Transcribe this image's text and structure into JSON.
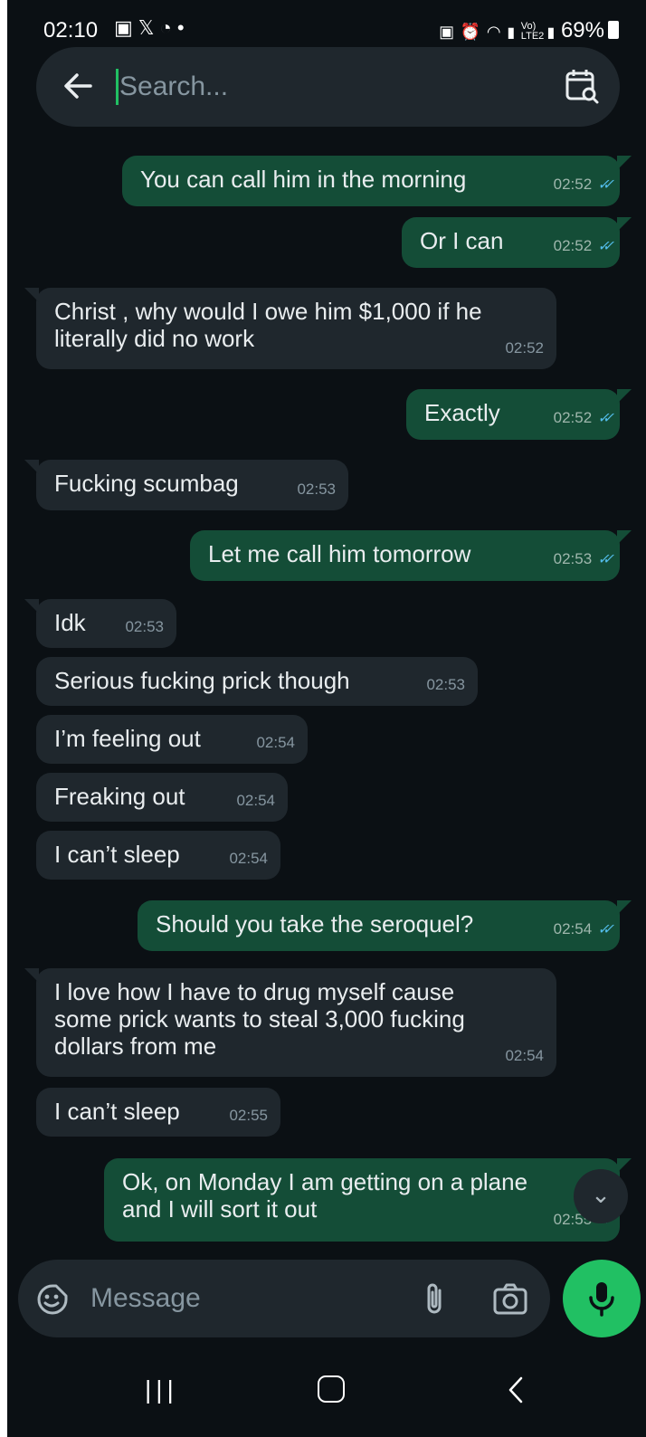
{
  "status_bar": {
    "time": "02:10",
    "network_label": "Vo) LTE2",
    "battery": "69%"
  },
  "search": {
    "placeholder": "Search..."
  },
  "messages": [
    {
      "dir": "out",
      "text": "You can call him in the morning",
      "time": "02:52",
      "status": "read"
    },
    {
      "dir": "out",
      "text": "Or I can",
      "time": "02:52",
      "status": "read"
    },
    {
      "dir": "in",
      "text": "Christ , why would I owe him $1,000 if he\nliterally did no work",
      "time": "02:52"
    },
    {
      "dir": "out",
      "text": "Exactly",
      "time": "02:52",
      "status": "read"
    },
    {
      "dir": "in",
      "text": "Fucking scumbag",
      "time": "02:53"
    },
    {
      "dir": "out",
      "text": "Let me call him tomorrow",
      "time": "02:53",
      "status": "read"
    },
    {
      "dir": "in",
      "text": "Idk",
      "time": "02:53"
    },
    {
      "dir": "in",
      "text": "Serious fucking prick though",
      "time": "02:53"
    },
    {
      "dir": "in",
      "text": "I’m feeling out",
      "time": "02:54"
    },
    {
      "dir": "in",
      "text": "Freaking out",
      "time": "02:54"
    },
    {
      "dir": "in",
      "text": "I can’t sleep",
      "time": "02:54"
    },
    {
      "dir": "out",
      "text": "Should you take the seroquel?",
      "time": "02:54",
      "status": "read"
    },
    {
      "dir": "in",
      "text": "I love how I have to drug myself cause\nsome prick wants to steal 3,000 fucking\ndollars from me",
      "time": "02:54"
    },
    {
      "dir": "in",
      "text": "I can’t sleep",
      "time": "02:55"
    },
    {
      "dir": "out",
      "text": "Ok, on Monday I am getting on a plane\nand I will sort it out",
      "time": "02:55",
      "status": "read"
    }
  ],
  "composer": {
    "placeholder": "Message"
  },
  "colors": {
    "background": "#0b1014",
    "outgoing_bubble": "#144d37",
    "incoming_bubble": "#1f272d",
    "accent": "#21c063",
    "read_tick": "#53bdeb"
  },
  "icons": {
    "status": [
      "gallery-icon",
      "x-logo-icon",
      "timer-icon",
      "dot-icon",
      "battery-saver-icon",
      "alarm-icon",
      "wifi-icon",
      "signal-icon",
      "battery-icon"
    ],
    "search_bar": [
      "back-arrow-icon",
      "calendar-search-icon"
    ],
    "composer": [
      "sticker-icon",
      "attach-icon",
      "camera-icon",
      "mic-icon"
    ],
    "nav": [
      "recents-icon",
      "home-icon",
      "back-icon"
    ],
    "scroll": "double-chevron-down-icon"
  }
}
